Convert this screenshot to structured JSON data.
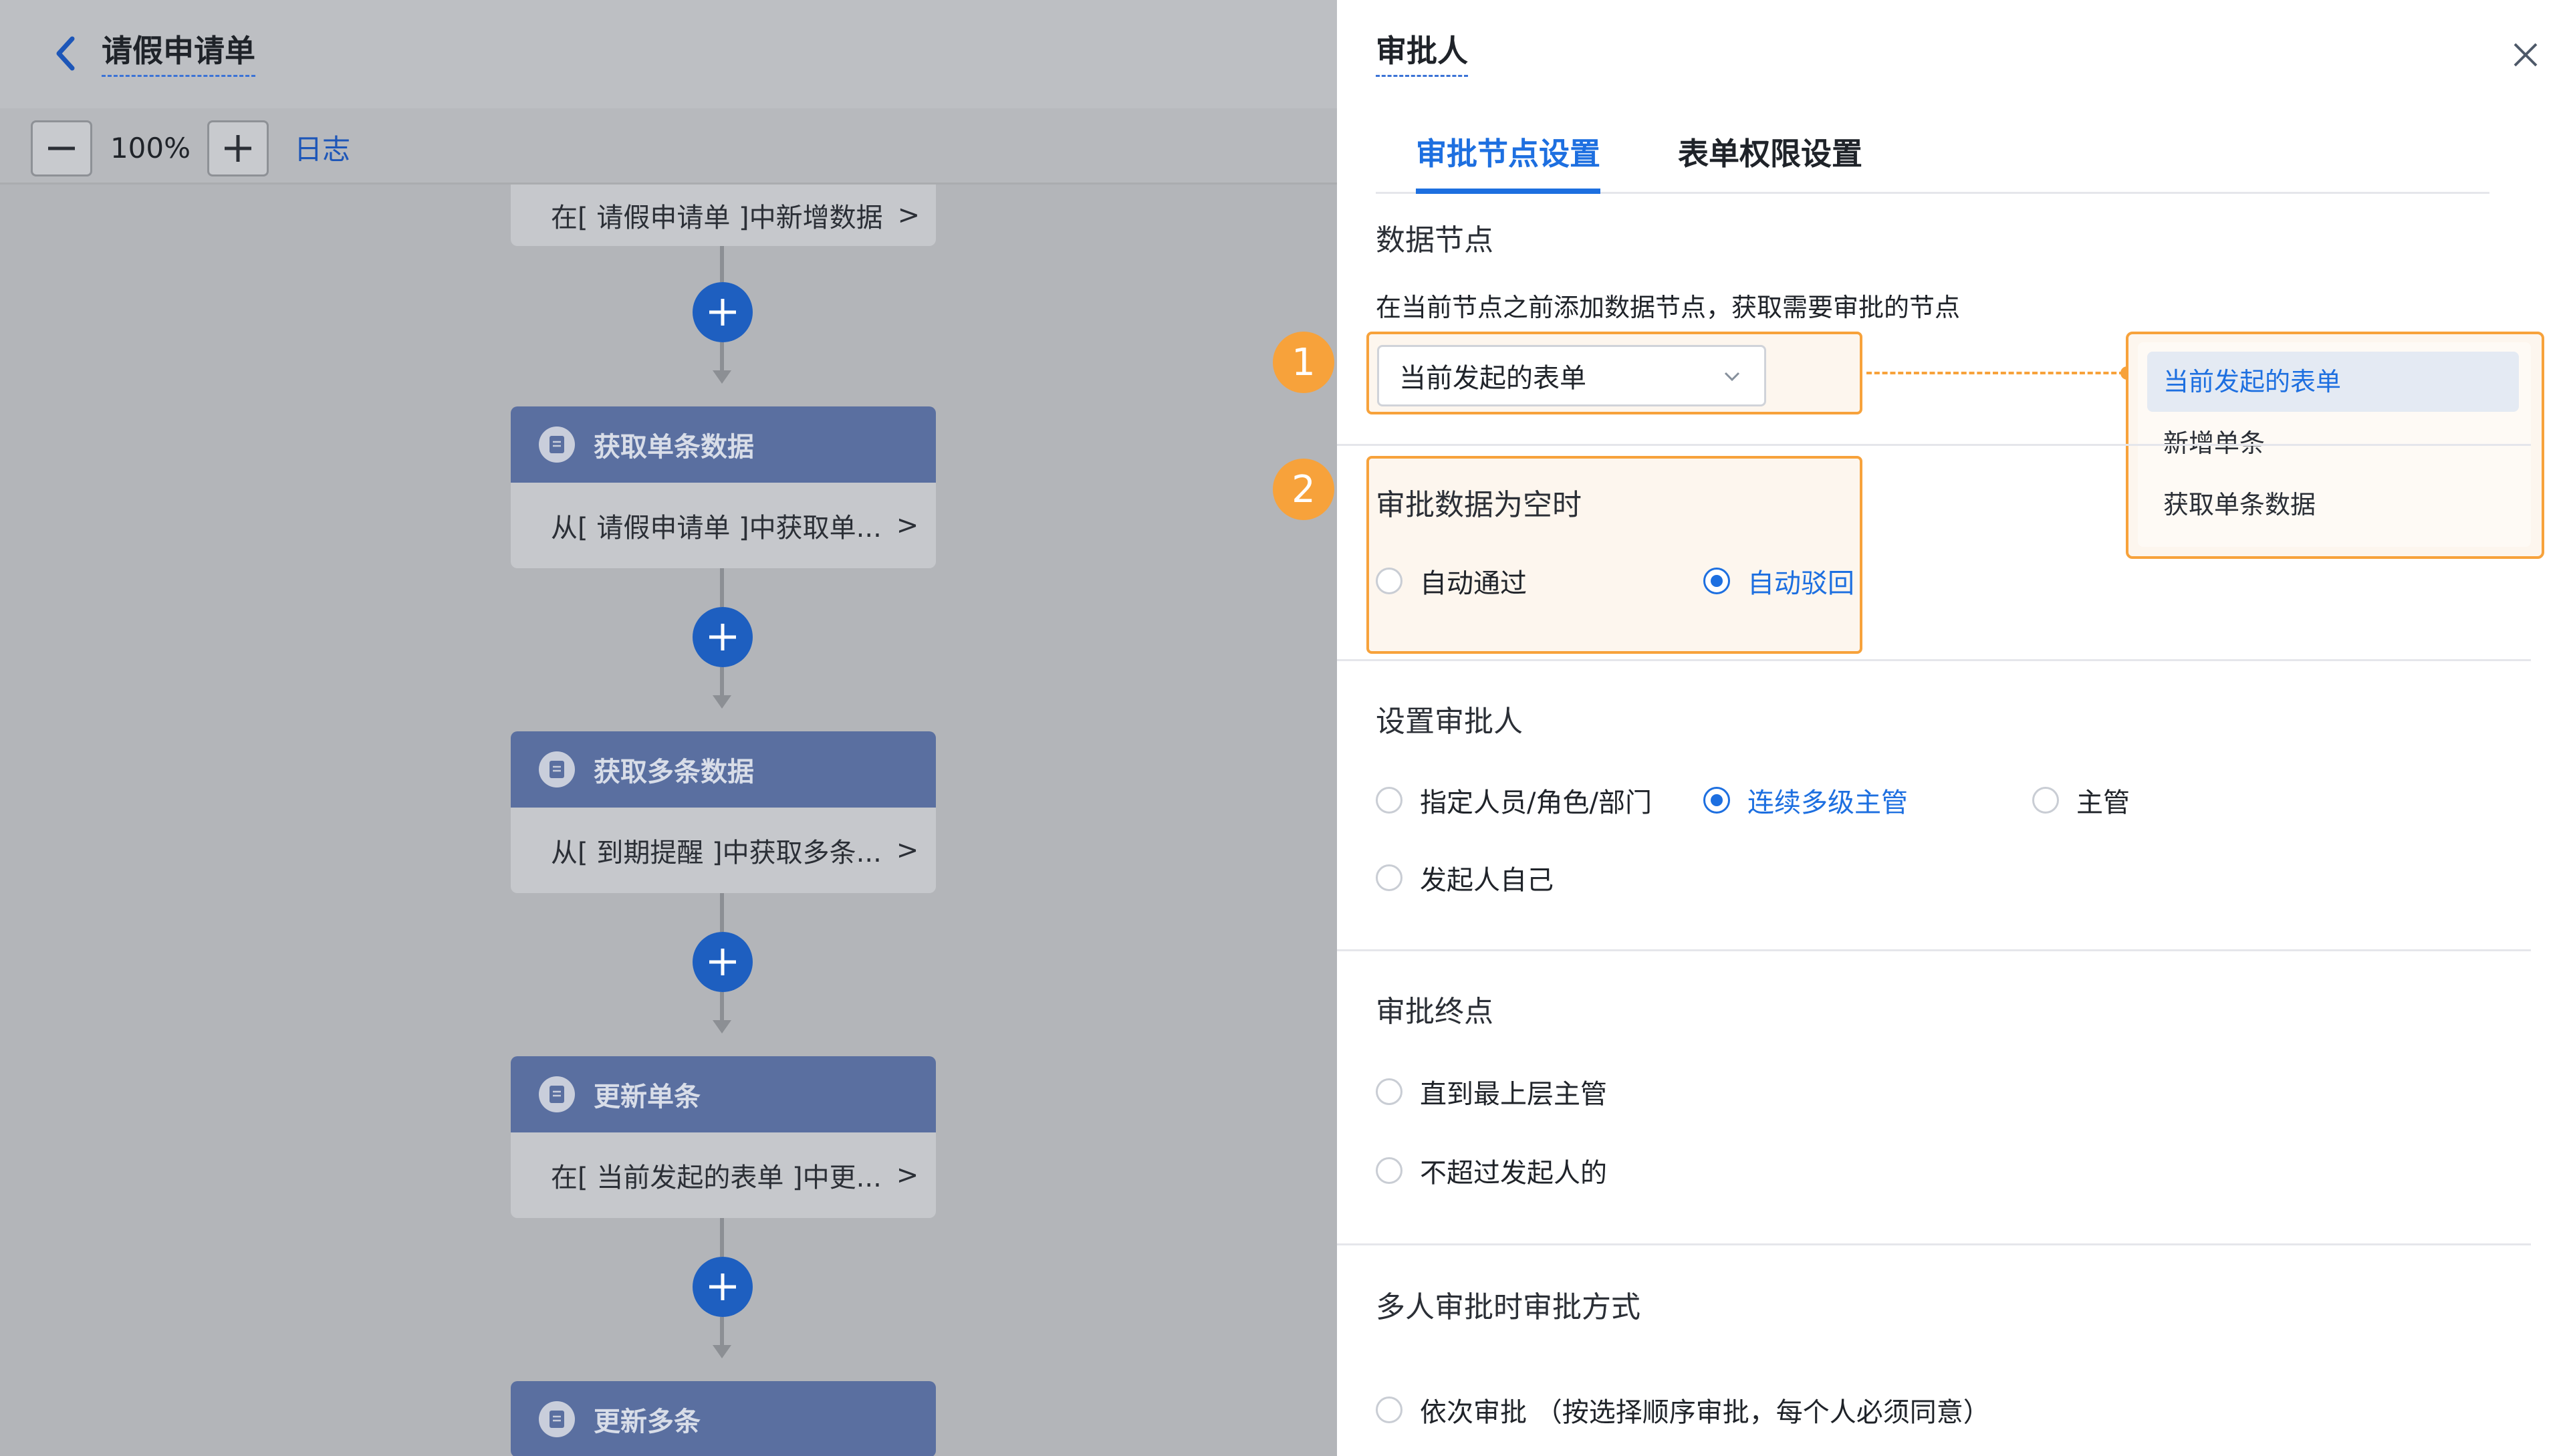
{
  "header": {
    "title": "请假申请单"
  },
  "toolbar": {
    "zoom": "100%",
    "log_label": "日志"
  },
  "flow": {
    "first_card": "在[ 请假申请单 ]中新增数据",
    "nodes": [
      {
        "title": "获取单条数据",
        "body": "从[ 请假申请单 ]中获取单..."
      },
      {
        "title": "获取多条数据",
        "body": "从[ 到期提醒 ]中获取多条..."
      },
      {
        "title": "更新单条",
        "body": "在[ 当前发起的表单 ]中更..."
      },
      {
        "title": "更新多条"
      }
    ],
    "chevron": ">"
  },
  "panel": {
    "title": "审批人",
    "tabs": [
      "审批节点设置",
      "表单权限设置"
    ],
    "data_node": {
      "title": "数据节点",
      "hint": "在当前节点之前添加数据节点，获取需要审批的节点",
      "selected": "当前发起的表单",
      "options": [
        "当前发起的表单",
        "新增单条",
        "获取单条数据"
      ]
    },
    "empty_data": {
      "title": "审批数据为空时",
      "options": [
        "自动通过",
        "自动驳回"
      ],
      "selected_index": 1
    },
    "approver": {
      "title": "设置审批人",
      "options": [
        "指定人员/角色/部门",
        "连续多级主管",
        "主管",
        "发起人自己"
      ],
      "selected_index": 1
    },
    "end_point": {
      "title": "审批终点",
      "options": [
        "直到最上层主管",
        "不超过发起人的"
      ]
    },
    "multi": {
      "title": "多人审批时审批方式",
      "options": [
        "依次审批 （按选择顺序审批，每个人必须同意）"
      ]
    }
  },
  "annotations": {
    "badge1": "1",
    "badge2": "2"
  },
  "colors": {
    "accent": "#1d6fe0",
    "highlight": "#f7a23b",
    "node_header": "#5a6fa0",
    "add_button": "#1e5fc0"
  }
}
